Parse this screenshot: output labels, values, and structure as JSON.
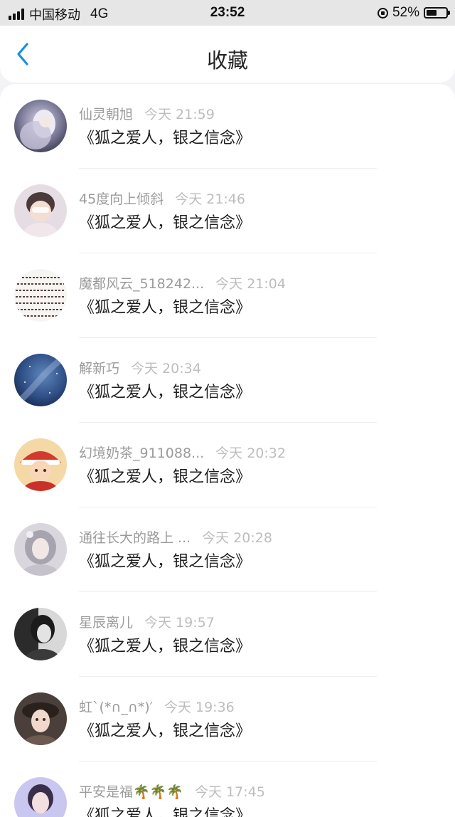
{
  "status_bar": {
    "carrier": "中国移动",
    "network": "4G",
    "time": "23:52",
    "battery_percent_text": "52%",
    "battery_level": 0.52
  },
  "header": {
    "title": "收藏",
    "back_icon": "chevron-left-icon",
    "accent_color": "#1a8fe0"
  },
  "favorites": [
    {
      "username": "仙灵朝旭",
      "time": "今天 21:59",
      "title": "《狐之爱人，银之信念》"
    },
    {
      "username": "45度向上倾斜",
      "time": "今天 21:46",
      "title": "《狐之爱人，银之信念》"
    },
    {
      "username": "魔都风云_518242...",
      "time": "今天 21:04",
      "title": "《狐之爱人，银之信念》"
    },
    {
      "username": "解新巧",
      "time": "今天 20:34",
      "title": "《狐之爱人，银之信念》"
    },
    {
      "username": "幻境奶茶_911088...",
      "time": "今天 20:32",
      "title": "《狐之爱人，银之信念》"
    },
    {
      "username": "通往长大的路上 ...",
      "time": "今天 20:28",
      "title": "《狐之爱人，银之信念》"
    },
    {
      "username": "星辰离儿",
      "time": "今天 19:57",
      "title": "《狐之爱人，银之信念》"
    },
    {
      "username": "虹`(*∩_∩*)′",
      "time": "今天 19:36",
      "title": "《狐之爱人，银之信念》"
    },
    {
      "username": "平安是福🌴🌴🌴",
      "time": "今天 17:45",
      "title": "《狐之爱人，银之信念》"
    }
  ]
}
